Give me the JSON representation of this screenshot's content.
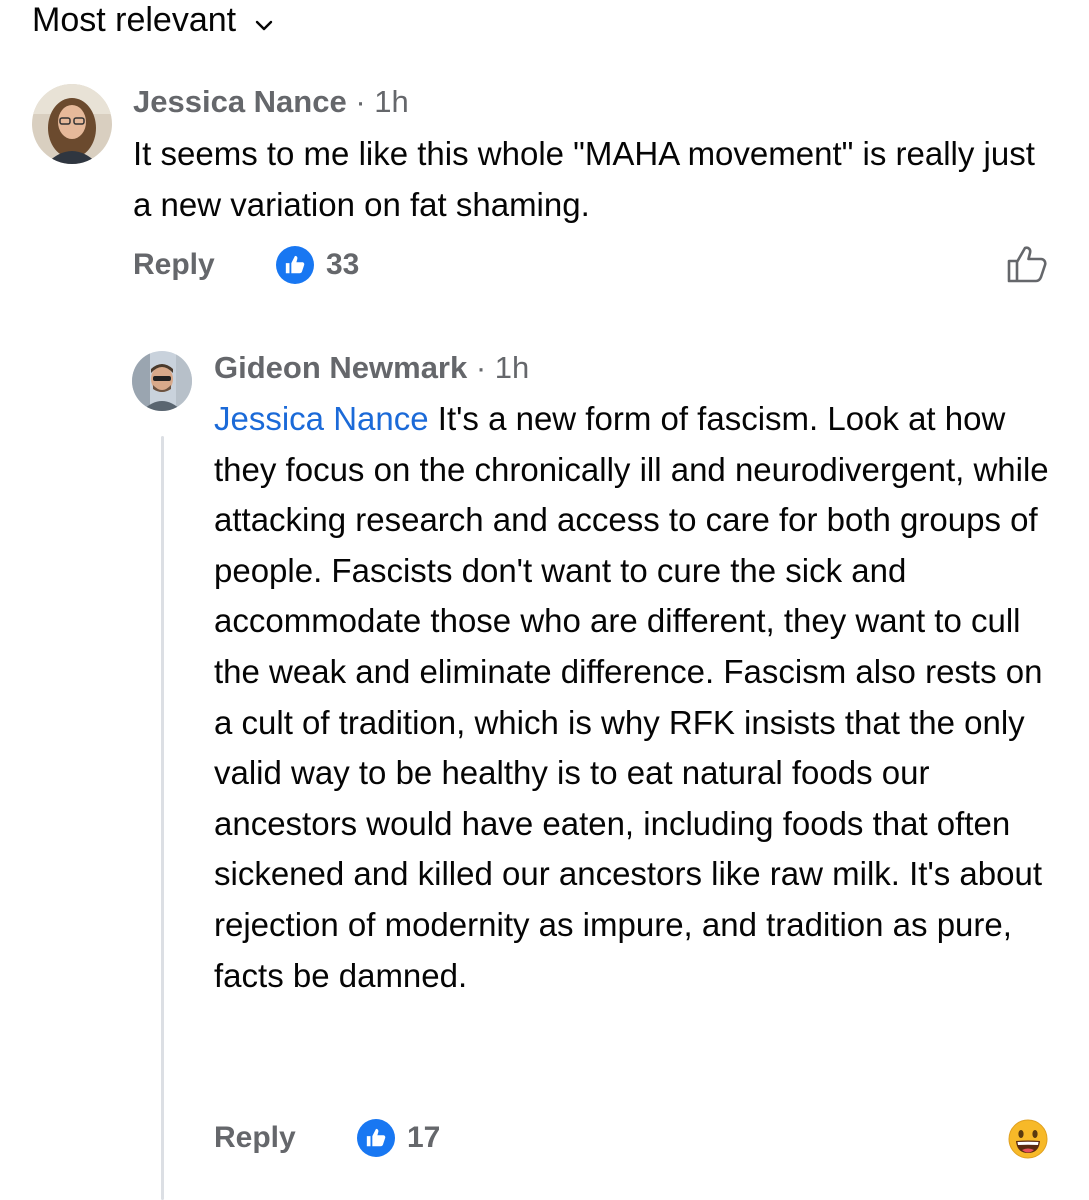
{
  "sort": {
    "label": "Most relevant"
  },
  "comments": [
    {
      "author": "Jessica Nance",
      "time": " · 1h",
      "text": "It seems to me like this whole \"MAHA movement\" is really just a new variation on fat shaming.",
      "reply_label": "Reply",
      "like_count": "33"
    },
    {
      "author": "Gideon Newmark",
      "time": " · 1h",
      "mention": "Jessica Nance",
      "text": " It's a new form of fascism. Look at how they focus on the chronically ill and neurodivergent, while attacking research and access to care for both groups of people. Fascists don't want to cure the sick and accommodate those who are different, they want to cull the weak and eliminate difference. Fascism also rests on a cult of tradition, which is why RFK insists that the only valid way to be healthy is to eat natural foods our ancestors would have eaten, including foods that often sickened and killed our ancestors like raw milk. It's about rejection of modernity as impure, and tradition as pure, facts be damned.",
      "reply_label": "Reply",
      "like_count": "17"
    }
  ],
  "colors": {
    "accent": "#1877f2",
    "secondary_text": "#65676b",
    "mention": "#1b6ad8"
  },
  "icons": {
    "like_badge": "thumbs-up-icon",
    "like_action": "thumbs-up-outline-icon",
    "reaction": "grinning-emoji-icon"
  }
}
